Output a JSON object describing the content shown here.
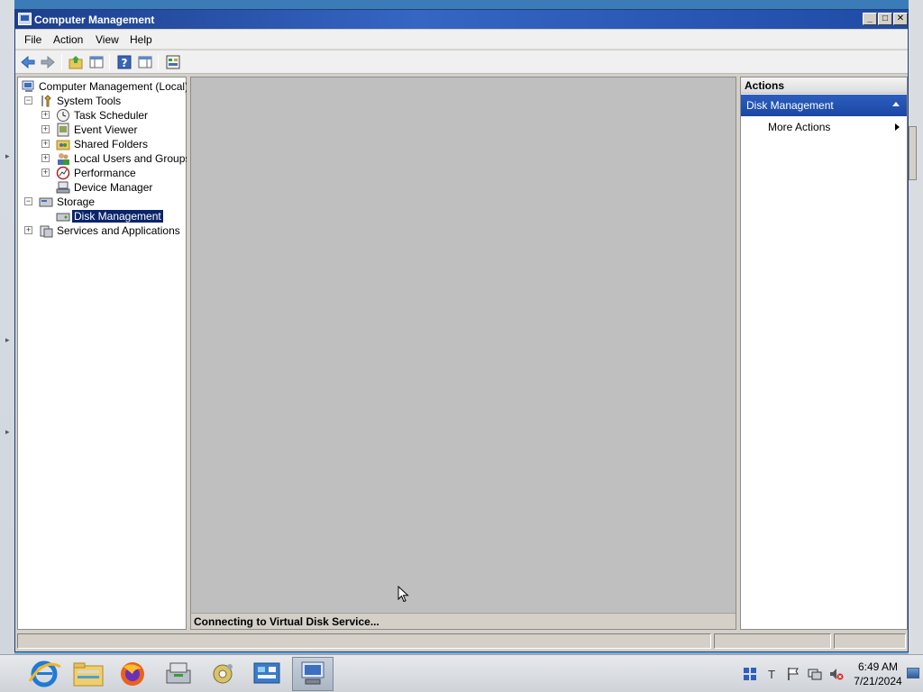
{
  "window": {
    "title": "Computer Management"
  },
  "menu": [
    "File",
    "Action",
    "View",
    "Help"
  ],
  "tree": {
    "root": "Computer Management (Local)",
    "system_tools": "System Tools",
    "system_tools_items": [
      "Task Scheduler",
      "Event Viewer",
      "Shared Folders",
      "Local Users and Groups",
      "Performance",
      "Device Manager"
    ],
    "storage": "Storage",
    "storage_items": [
      "Disk Management"
    ],
    "services": "Services and Applications",
    "selected": "Disk Management"
  },
  "center": {
    "status_text": "Connecting to Virtual Disk Service..."
  },
  "actions": {
    "header": "Actions",
    "section": "Disk Management",
    "items": [
      "More Actions"
    ]
  },
  "taskbar": {
    "apps": [
      "internet-explorer",
      "file-explorer",
      "firefox",
      "server-manager",
      "tools",
      "control-panel",
      "computer-management"
    ],
    "active_app": "computer-management",
    "time": "6:49 AM",
    "date": "7/21/2024"
  },
  "colors": {
    "title_bar": "#1c3e8c",
    "selection": "#0a246a",
    "actions_section": "#2d5fbe",
    "center_bg": "#bfbfbf"
  }
}
